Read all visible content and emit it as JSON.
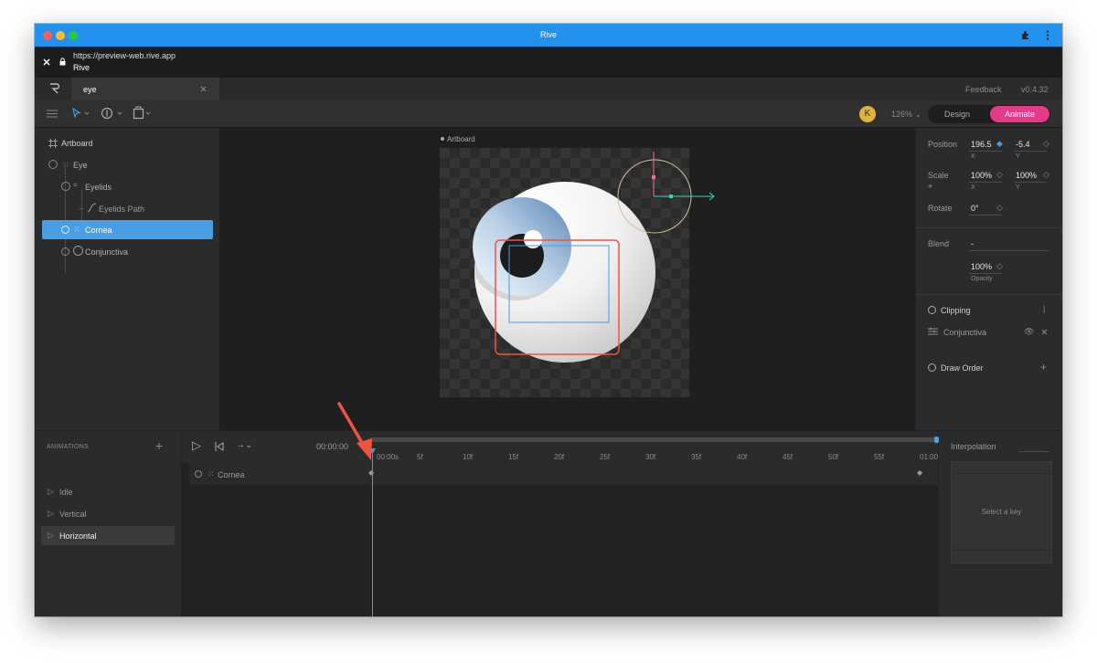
{
  "window": {
    "title": "Rive"
  },
  "address": {
    "url": "https://preview-web.rive.app",
    "page_title": "Rive"
  },
  "tab": {
    "name": "eye"
  },
  "header": {
    "feedback": "Feedback",
    "version": "v0.4.32"
  },
  "toolbar": {
    "zoom": "126%",
    "avatar": "K",
    "design": "Design",
    "animate": "Animate"
  },
  "hierarchy": {
    "items": [
      {
        "label": "Artboard"
      },
      {
        "label": "Eye"
      },
      {
        "label": "Eyelids"
      },
      {
        "label": "Eyelids Path"
      },
      {
        "label": "Cornea"
      },
      {
        "label": "Conjunctiva"
      }
    ]
  },
  "stage": {
    "artboard_label": "Artboard"
  },
  "inspector": {
    "position_label": "Position",
    "position_x": "196.5",
    "position_y": "-5.4",
    "x_label": "X",
    "y_label": "Y",
    "scale_label": "Scale",
    "scale_x": "100%",
    "scale_y": "100%",
    "rotate_label": "Rotate",
    "rotate_value": "0°",
    "blend_label": "Blend",
    "blend_value": "-",
    "opacity_value": "100%",
    "opacity_label": "Opacity",
    "clipping_label": "Clipping",
    "clip_item": "Conjunctiva",
    "draw_order_label": "Draw Order"
  },
  "animations": {
    "header": "ANIMATIONS",
    "items": [
      {
        "label": "Idle"
      },
      {
        "label": "Vertical"
      },
      {
        "label": "Horizontal"
      }
    ]
  },
  "timeline": {
    "time": "00:00:00",
    "ticks": [
      "00:00s",
      "5f",
      "10f",
      "15f",
      "20f",
      "25f",
      "30f",
      "35f",
      "40f",
      "45f",
      "50f",
      "55f",
      "01:00"
    ],
    "track_label": "Cornea",
    "playhead_fraction": 0
  },
  "interpolation": {
    "label": "Interpolation",
    "placeholder": "Select a key"
  },
  "colors": {
    "accent": "#3d9be9",
    "animate": "#e5398a",
    "titlebar": "#2392ee",
    "arrow": "#f0533f"
  }
}
